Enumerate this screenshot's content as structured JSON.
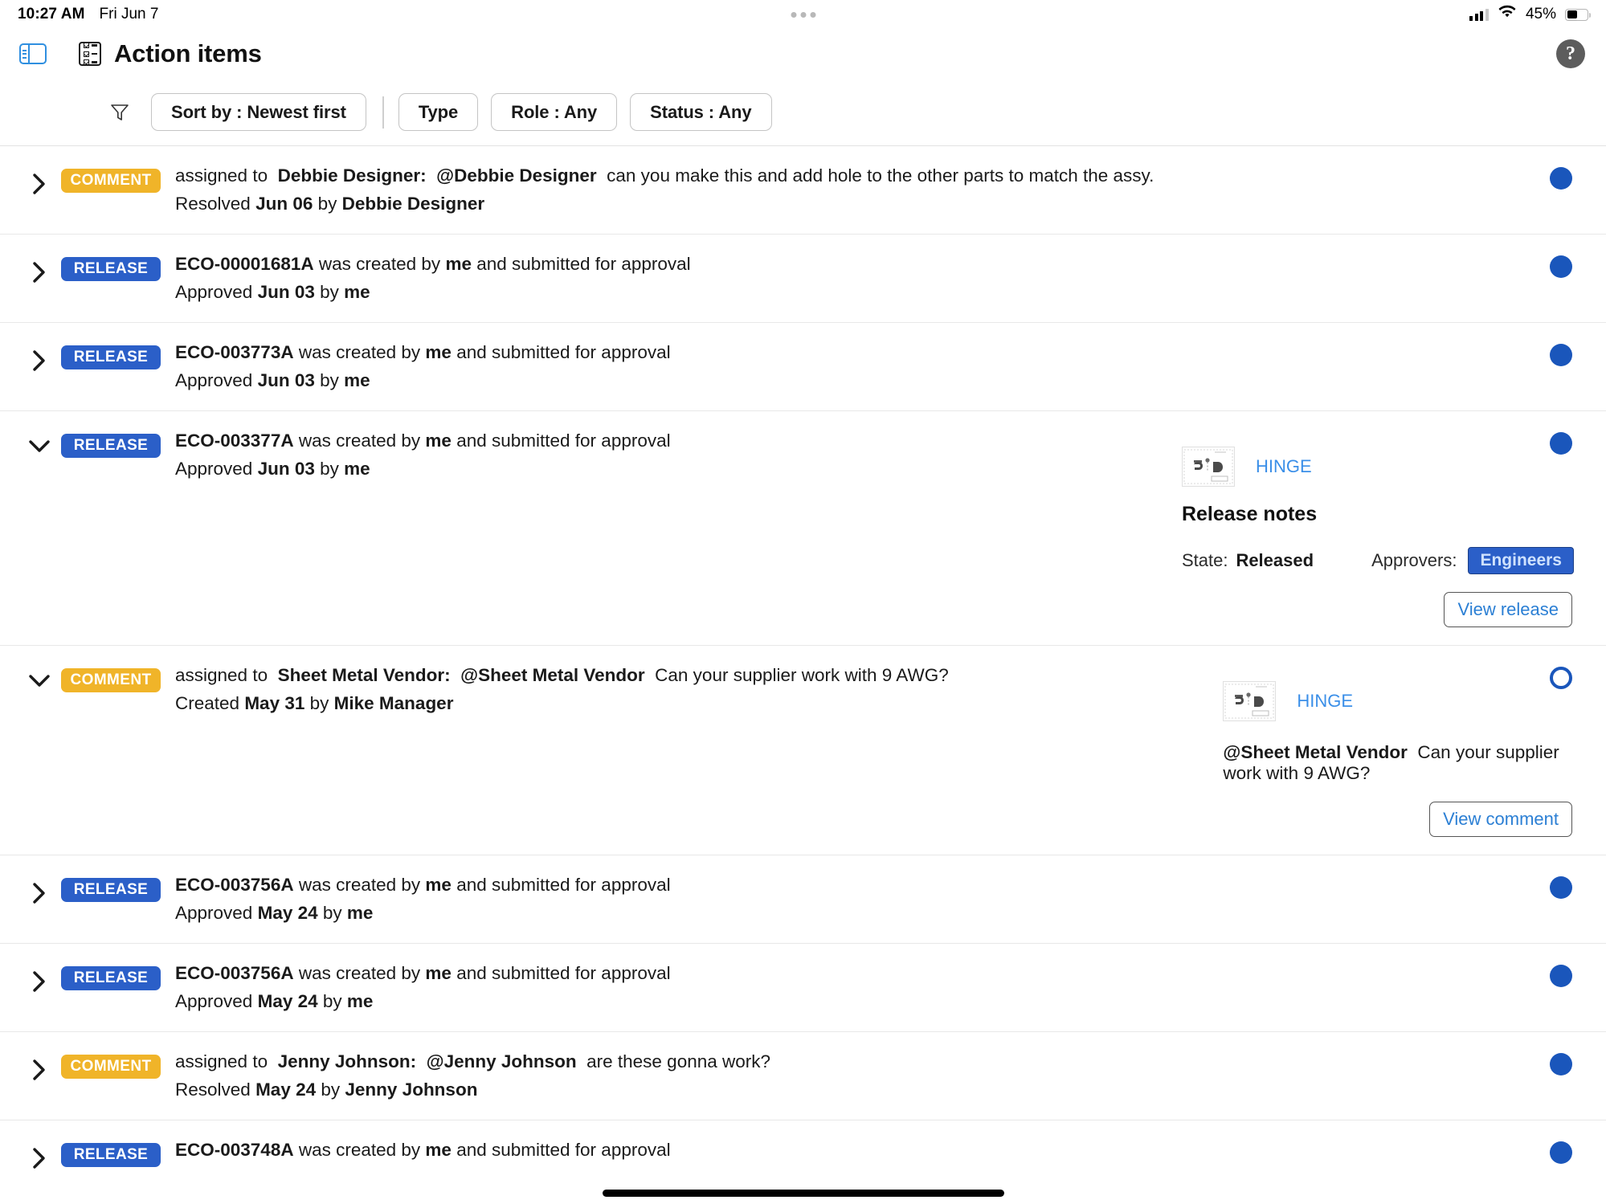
{
  "status_bar": {
    "time": "10:27 AM",
    "date": "Fri Jun 7",
    "battery_percent": "45%",
    "wifi_icon": "wifi-icon",
    "signal_icon": "cellular-signal-icon",
    "battery_icon": "battery-icon"
  },
  "header": {
    "sidebar_toggle_icon": "sidebar-toggle-icon",
    "title_icon": "checklist-icon",
    "title": "Action items",
    "help_icon": "help-question-icon"
  },
  "filters": {
    "funnel_icon": "filter-funnel-icon",
    "sort": "Sort by : Newest first",
    "type": "Type",
    "role": "Role : Any",
    "status": "Status : Any"
  },
  "colors": {
    "comment_badge": "#f0b429",
    "release_badge": "#2b5fc8",
    "status_dot": "#1a56bb",
    "link": "#3b8fe8",
    "accent_blue": "#2f8fe0"
  },
  "items": [
    {
      "id": "row-1",
      "type": "COMMENT",
      "expanded": false,
      "status": "filled",
      "line1_prefix": "assigned to",
      "line1_assignee": "Debbie Designer:",
      "line1_mention": "@Debbie Designer",
      "line1_text": "can you make this and add hole to the other parts to match the assy.",
      "line2_prefix": "Resolved",
      "line2_date": "Jun 06",
      "line2_by": "by",
      "line2_person": "Debbie Designer"
    },
    {
      "id": "row-2",
      "type": "RELEASE",
      "expanded": false,
      "status": "filled",
      "eco": "ECO-00001681A",
      "line1_text": "was created by",
      "line1_actor": "me",
      "line1_tail": "and submitted for approval",
      "line2_prefix": "Approved",
      "line2_date": "Jun 03",
      "line2_by": "by",
      "line2_person": "me"
    },
    {
      "id": "row-3",
      "type": "RELEASE",
      "expanded": false,
      "status": "filled",
      "eco": "ECO-003773A",
      "line1_text": "was created by",
      "line1_actor": "me",
      "line1_tail": "and submitted for approval",
      "line2_prefix": "Approved",
      "line2_date": "Jun 03",
      "line2_by": "by",
      "line2_person": "me"
    },
    {
      "id": "row-4",
      "type": "RELEASE",
      "expanded": true,
      "status": "filled",
      "eco": "ECO-003377A",
      "line1_text": "was created by",
      "line1_actor": "me",
      "line1_tail": "and submitted for approval",
      "line2_prefix": "Approved",
      "line2_date": "Jun 03",
      "line2_by": "by",
      "line2_person": "me",
      "detail": {
        "thumbnail_icon": "cad-drawing-thumbnail",
        "part_name": "HINGE",
        "section_title": "Release notes",
        "state_label": "State:",
        "state_value": "Released",
        "approvers_label": "Approvers:",
        "approvers_value": "Engineers",
        "action_label": "View release"
      }
    },
    {
      "id": "row-5",
      "type": "COMMENT",
      "expanded": true,
      "status": "hollow",
      "line1_prefix": "assigned to",
      "line1_assignee": "Sheet Metal Vendor:",
      "line1_mention": "@Sheet Metal Vendor",
      "line1_text": "Can your supplier work with 9 AWG?",
      "line2_prefix": "Created",
      "line2_date": "May 31",
      "line2_by": "by",
      "line2_person": "Mike Manager",
      "detail": {
        "thumbnail_icon": "cad-drawing-thumbnail",
        "part_name": "HINGE",
        "body_mention": "@Sheet Metal Vendor",
        "body_text": "Can your supplier work with 9 AWG?",
        "action_label": "View comment"
      }
    },
    {
      "id": "row-6",
      "type": "RELEASE",
      "expanded": false,
      "status": "filled",
      "eco": "ECO-003756A",
      "line1_text": "was created by",
      "line1_actor": "me",
      "line1_tail": "and submitted for approval",
      "line2_prefix": "Approved",
      "line2_date": "May 24",
      "line2_by": "by",
      "line2_person": "me"
    },
    {
      "id": "row-7",
      "type": "RELEASE",
      "expanded": false,
      "status": "filled",
      "eco": "ECO-003756A",
      "line1_text": "was created by",
      "line1_actor": "me",
      "line1_tail": "and submitted for approval",
      "line2_prefix": "Approved",
      "line2_date": "May 24",
      "line2_by": "by",
      "line2_person": "me"
    },
    {
      "id": "row-8",
      "type": "COMMENT",
      "expanded": false,
      "status": "filled",
      "line1_prefix": "assigned to",
      "line1_assignee": "Jenny Johnson:",
      "line1_mention": "@Jenny Johnson",
      "line1_text": "are these gonna work?",
      "line2_prefix": "Resolved",
      "line2_date": "May 24",
      "line2_by": "by",
      "line2_person": "Jenny Johnson"
    },
    {
      "id": "row-9",
      "type": "RELEASE",
      "expanded": false,
      "status": "filled",
      "eco": "ECO-003748A",
      "line1_text": "was created by",
      "line1_actor": "me",
      "line1_tail": "and submitted for approval",
      "line2_prefix": "",
      "line2_date": "",
      "line2_by": "",
      "line2_person": ""
    }
  ]
}
